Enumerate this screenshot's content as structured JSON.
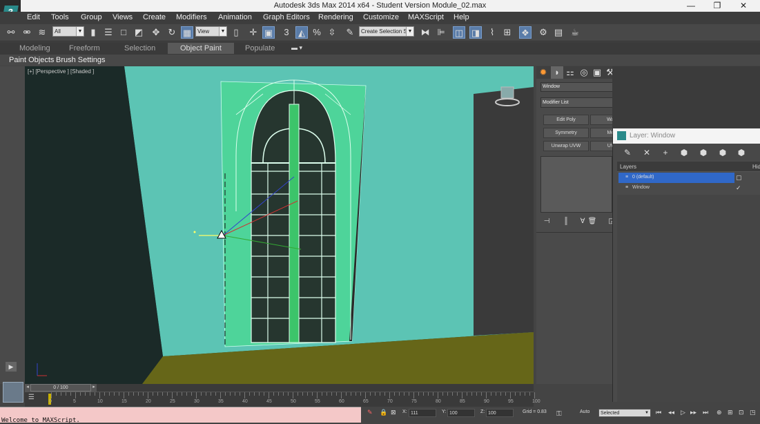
{
  "window": {
    "title": "Autodesk 3ds Max  2014 x64  - Student Version   Module_02.max",
    "minimize": "—",
    "restore": "❐",
    "close": "✕"
  },
  "menu": [
    "Edit",
    "Tools",
    "Group",
    "Views",
    "Create",
    "Modifiers",
    "Animation",
    "Graph Editors",
    "Rendering",
    "Customize",
    "MAXScript",
    "Help"
  ],
  "toolbar": {
    "selection_filter": "All",
    "ref_coord": "View",
    "named_selection": "Create Selection S"
  },
  "ribbon": {
    "tabs": [
      "Modeling",
      "Freeform",
      "Selection",
      "Object Paint",
      "Populate"
    ],
    "active_tab": "Object Paint"
  },
  "subbar": {
    "items": [
      "Paint Objects",
      "Brush Settings"
    ]
  },
  "viewport": {
    "label": "[+] [Perspective ] [Shaded ]"
  },
  "command_panel": {
    "object_name": "Window",
    "object_color": "#1aa050",
    "modifier_list": "Modifier List",
    "buttons": [
      "Edit Poly",
      "Wave",
      "Symmetry",
      "Mesh",
      "Unwrap UVW",
      "UVW"
    ]
  },
  "layer_window": {
    "title": "Layer: Window",
    "col_layers": "Layers",
    "col_hide": "Hid",
    "rows": [
      {
        "name": "0 (default)",
        "selected": true
      },
      {
        "name": "Window",
        "selected": false
      }
    ]
  },
  "timeline": {
    "frame": "0 / 100",
    "ticks": [
      "0",
      "5",
      "10",
      "15",
      "20",
      "25",
      "30",
      "35",
      "40",
      "45",
      "50",
      "55",
      "60",
      "65",
      "70",
      "75",
      "80",
      "85",
      "90",
      "95",
      "100"
    ]
  },
  "status": {
    "maxscript": "Welcome to MAXScript.",
    "x_label": "X:",
    "x": "111",
    "y_label": "Y:",
    "y": "100",
    "z_label": "Z:",
    "z": "100",
    "grid": "Grid = 0.83",
    "auto": "Auto",
    "key_filter": "Selected"
  }
}
